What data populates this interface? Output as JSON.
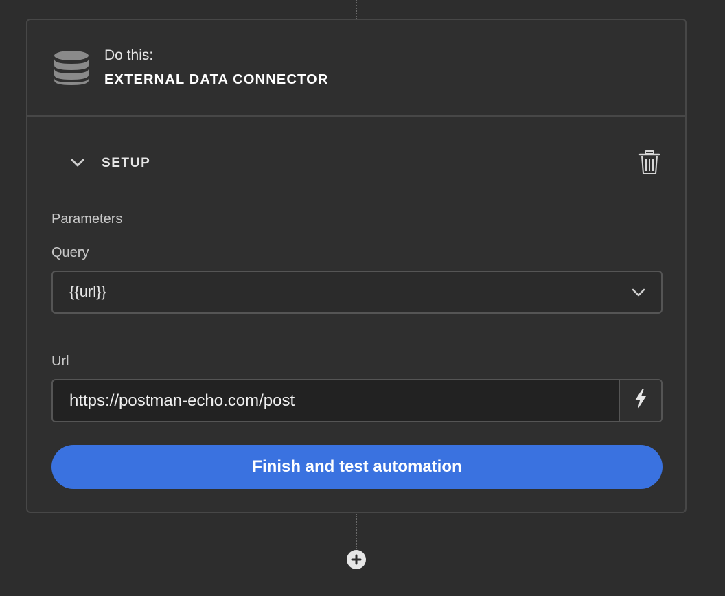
{
  "card": {
    "header": {
      "subtitle": "Do this:",
      "title": "EXTERNAL DATA CONNECTOR",
      "icon": "database-icon"
    },
    "setup": {
      "label": "SETUP",
      "expanded": true,
      "delete_icon": "trash-icon"
    },
    "parameters_label": "Parameters",
    "query": {
      "label": "Query",
      "value": "{{url}}"
    },
    "url": {
      "label": "Url",
      "value": "https://postman-echo.com/post",
      "binding_icon": "lightning-icon"
    },
    "finish_button": "Finish and test automation"
  },
  "add_step_icon": "plus-circle-icon",
  "colors": {
    "background": "#2d2d2d",
    "card": "#2f2f2f",
    "border": "#474747",
    "accent": "#3a72e0"
  }
}
